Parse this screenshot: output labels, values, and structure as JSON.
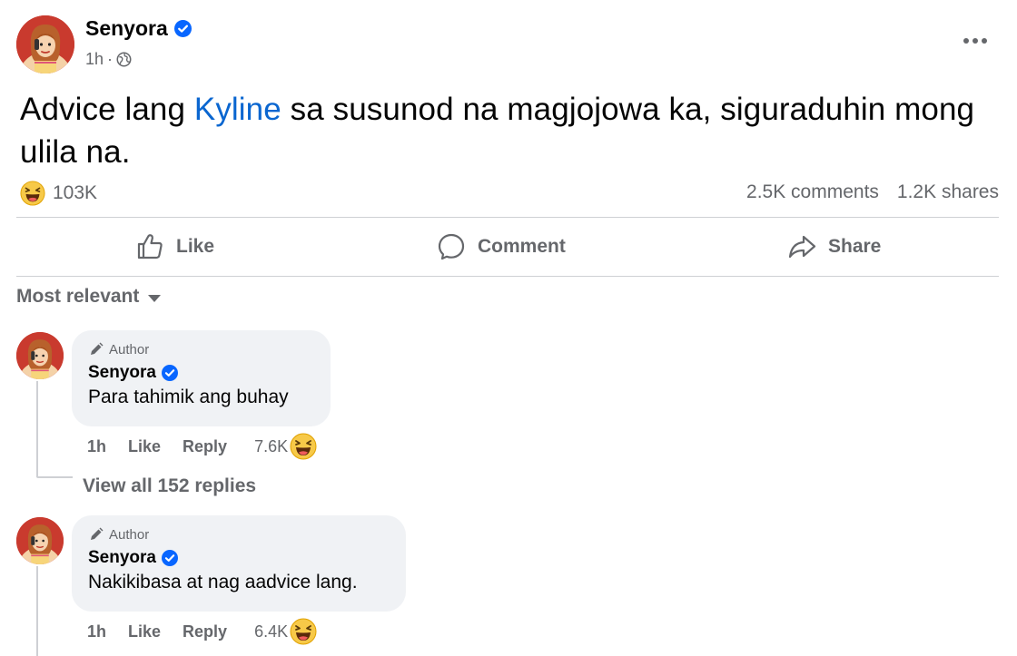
{
  "post": {
    "author": "Senyora",
    "time": "1h",
    "meta_separator": "·",
    "text_before": "Advice lang ",
    "mention": "Kyline",
    "text_after": " sa susunod na magjojowa ka, siguraduhin mong ulila na.",
    "reaction_count": "103K",
    "comments": "2.5K comments",
    "shares": "1.2K shares"
  },
  "actions": {
    "like": "Like",
    "comment": "Comment",
    "share": "Share"
  },
  "sort_label": "Most relevant",
  "comments": [
    {
      "tag": "Author",
      "name": "Senyora",
      "text": "Para tahimik ang buhay",
      "time": "1h",
      "like": "Like",
      "reply": "Reply",
      "reaction_count": "7.6K"
    },
    {
      "tag": "Author",
      "name": "Senyora",
      "text": "Nakikibasa at nag aadvice lang.",
      "time": "1h",
      "like": "Like",
      "reply": "Reply",
      "reaction_count": "6.4K"
    }
  ],
  "view_replies": "View all 152 replies",
  "colors": {
    "mention": "#0a66d0",
    "verified": "#0866ff",
    "secondary_text": "#65676b",
    "bubble": "#f0f2f5"
  },
  "icons": {
    "verified": "verified-badge-icon",
    "globe": "globe-icon",
    "more": "more-options-icon",
    "haha": "haha-emoji-icon",
    "like": "thumbs-up-icon",
    "comment": "comment-bubble-icon",
    "share": "share-arrow-icon",
    "author": "pen-icon",
    "caret": "caret-down-icon"
  }
}
